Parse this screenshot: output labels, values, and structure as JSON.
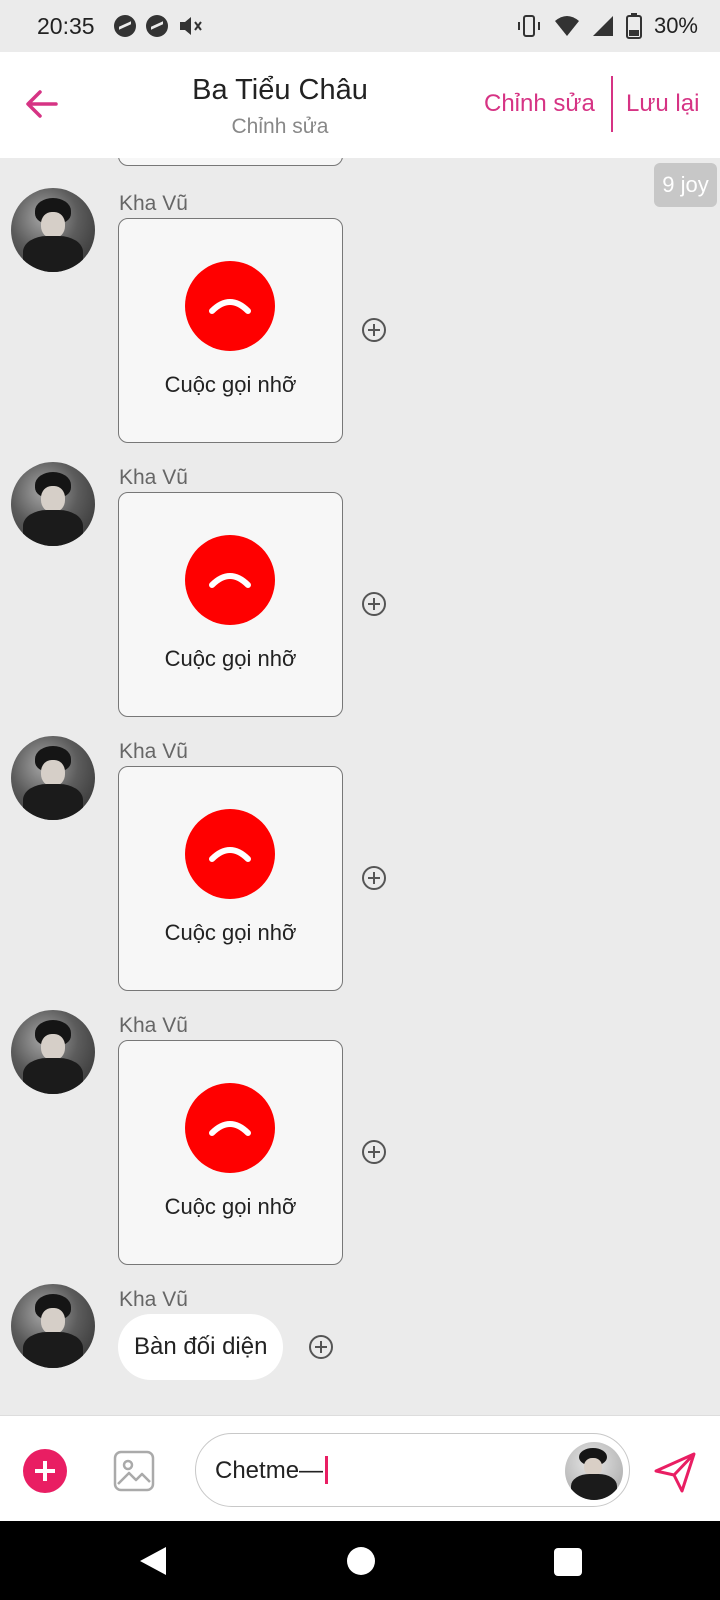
{
  "status_bar": {
    "time": "20:35",
    "battery": "30%",
    "icons": [
      "messenger-icon",
      "messenger-icon",
      "mute-icon",
      "vibrate-icon",
      "wifi-icon",
      "signal-icon",
      "battery-icon"
    ]
  },
  "header": {
    "title": "Ba Tiểu Châu",
    "subtitle": "Chỉnh sửa",
    "edit_label": "Chỉnh sửa",
    "save_label": "Lưu lại",
    "accent_color": "#d63384"
  },
  "chat": {
    "timestamp_badge": "9 joy",
    "messages": [
      {
        "sender": "Kha Vũ",
        "type": "missed-call",
        "label": "Cuộc gọi nhỡ"
      },
      {
        "sender": "Kha Vũ",
        "type": "missed-call",
        "label": "Cuộc gọi nhỡ"
      },
      {
        "sender": "Kha Vũ",
        "type": "missed-call",
        "label": "Cuộc gọi nhỡ"
      },
      {
        "sender": "Kha Vũ",
        "type": "missed-call",
        "label": "Cuộc gọi nhỡ"
      },
      {
        "sender": "Kha Vũ",
        "type": "text",
        "text": "Bàn đối diện"
      }
    ],
    "missed_call_color": "#ff0000"
  },
  "composer": {
    "input_value": "Chetme—",
    "plus_color": "#e91e63"
  }
}
